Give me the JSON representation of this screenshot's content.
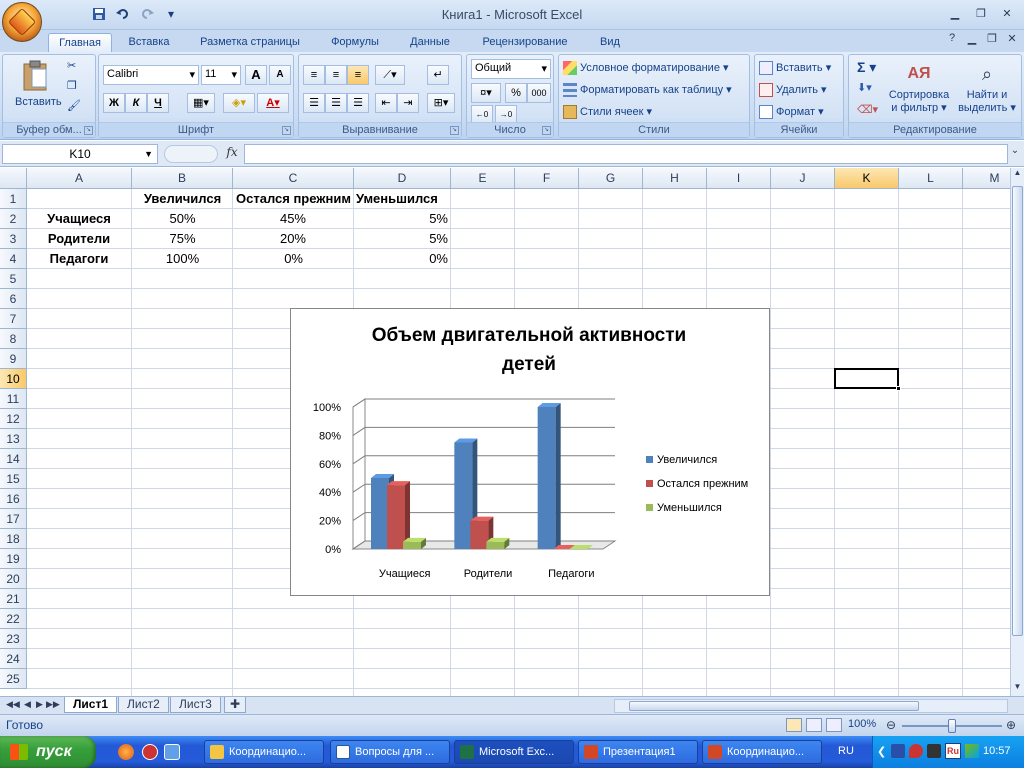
{
  "window": {
    "title": "Книга1 - Microsoft Excel"
  },
  "qat": {
    "save_icon": "save-icon",
    "undo_icon": "undo-icon",
    "redo_icon": "redo-icon"
  },
  "tabs": [
    "Главная",
    "Вставка",
    "Разметка страницы",
    "Формулы",
    "Данные",
    "Рецензирование",
    "Вид"
  ],
  "ribbon": {
    "clipboard": {
      "label": "Буфер обм...",
      "paste": "Вставить"
    },
    "font": {
      "label": "Шрифт",
      "name": "Calibri",
      "size": "11",
      "bold": "Ж",
      "italic": "К",
      "underline": "Ч",
      "grow": "A",
      "shrink": "A",
      "color_letter": "A"
    },
    "alignment": {
      "label": "Выравнивание"
    },
    "number": {
      "label": "Число",
      "format": "Общий",
      "percent": "%",
      "thousands": "000"
    },
    "styles": {
      "label": "Стили",
      "conditional": "Условное форматирование",
      "format_table": "Форматировать как таблицу",
      "cell_styles": "Стили ячеек"
    },
    "cells": {
      "label": "Ячейки",
      "insert": "Вставить",
      "delete": "Удалить",
      "format": "Формат"
    },
    "editing": {
      "label": "Редактирование",
      "sort1": "Сортировка",
      "sort2": "и фильтр",
      "find1": "Найти и",
      "find2": "выделить",
      "sigma": "Σ"
    }
  },
  "formula_bar": {
    "name_box": "K10",
    "fx": "fx",
    "formula": ""
  },
  "columns": [
    "A",
    "B",
    "C",
    "D",
    "E",
    "F",
    "G",
    "H",
    "I",
    "J",
    "K",
    "L",
    "M"
  ],
  "rows": [
    "1",
    "2",
    "3",
    "4",
    "5",
    "6",
    "7",
    "8",
    "9",
    "10",
    "11",
    "12",
    "13",
    "14",
    "15",
    "16",
    "17",
    "18",
    "19",
    "20",
    "21",
    "22",
    "23",
    "24",
    "25"
  ],
  "selected": {
    "column": "K",
    "row": "10"
  },
  "cells": {
    "b1": "Увеличился",
    "c1": "Остался прежним",
    "d1": "Уменьшился",
    "a2": "Учащиеся",
    "b2": "50%",
    "c2": "45%",
    "d2": "5%",
    "a3": "Родители",
    "b3": "75%",
    "c3": "20%",
    "d3": "5%",
    "a4": "Педагоги",
    "b4": "100%",
    "c4": "0%",
    "d4": "0%"
  },
  "chart_data": {
    "type": "bar",
    "title": "Объем двигательной активности детей",
    "categories": [
      "Учащиеся",
      "Родители",
      "Педагоги"
    ],
    "series": [
      {
        "name": "Увеличился",
        "values": [
          50,
          75,
          100
        ],
        "color": "#4f81bd"
      },
      {
        "name": "Остался прежним",
        "values": [
          45,
          20,
          0
        ],
        "color": "#c0504d"
      },
      {
        "name": "Уменьшился",
        "values": [
          5,
          5,
          0
        ],
        "color": "#9bbb59"
      }
    ],
    "yticks": [
      "0%",
      "20%",
      "40%",
      "60%",
      "80%",
      "100%"
    ],
    "ylim": [
      0,
      100
    ],
    "legend": "right",
    "grid": true
  },
  "sheets": [
    "Лист1",
    "Лист2",
    "Лист3"
  ],
  "status": {
    "text": "Готово",
    "zoom": "100%",
    "zoom_level": 100
  },
  "taskbar": {
    "start": "пуск",
    "items": [
      "Координацио...",
      "Вопросы для ...",
      "Microsoft Exc...",
      "Презентация1",
      "Координацио..."
    ],
    "lang": "RU",
    "clock": "10:57"
  }
}
